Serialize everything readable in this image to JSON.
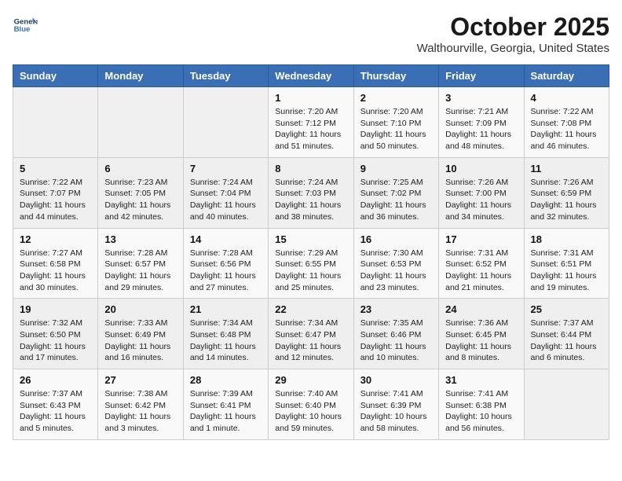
{
  "header": {
    "logo_line1": "General",
    "logo_line2": "Blue",
    "month": "October 2025",
    "location": "Walthourville, Georgia, United States"
  },
  "days_of_week": [
    "Sunday",
    "Monday",
    "Tuesday",
    "Wednesday",
    "Thursday",
    "Friday",
    "Saturday"
  ],
  "weeks": [
    [
      {
        "day": "",
        "info": ""
      },
      {
        "day": "",
        "info": ""
      },
      {
        "day": "",
        "info": ""
      },
      {
        "day": "1",
        "info": "Sunrise: 7:20 AM\nSunset: 7:12 PM\nDaylight: 11 hours and 51 minutes."
      },
      {
        "day": "2",
        "info": "Sunrise: 7:20 AM\nSunset: 7:10 PM\nDaylight: 11 hours and 50 minutes."
      },
      {
        "day": "3",
        "info": "Sunrise: 7:21 AM\nSunset: 7:09 PM\nDaylight: 11 hours and 48 minutes."
      },
      {
        "day": "4",
        "info": "Sunrise: 7:22 AM\nSunset: 7:08 PM\nDaylight: 11 hours and 46 minutes."
      }
    ],
    [
      {
        "day": "5",
        "info": "Sunrise: 7:22 AM\nSunset: 7:07 PM\nDaylight: 11 hours and 44 minutes."
      },
      {
        "day": "6",
        "info": "Sunrise: 7:23 AM\nSunset: 7:05 PM\nDaylight: 11 hours and 42 minutes."
      },
      {
        "day": "7",
        "info": "Sunrise: 7:24 AM\nSunset: 7:04 PM\nDaylight: 11 hours and 40 minutes."
      },
      {
        "day": "8",
        "info": "Sunrise: 7:24 AM\nSunset: 7:03 PM\nDaylight: 11 hours and 38 minutes."
      },
      {
        "day": "9",
        "info": "Sunrise: 7:25 AM\nSunset: 7:02 PM\nDaylight: 11 hours and 36 minutes."
      },
      {
        "day": "10",
        "info": "Sunrise: 7:26 AM\nSunset: 7:00 PM\nDaylight: 11 hours and 34 minutes."
      },
      {
        "day": "11",
        "info": "Sunrise: 7:26 AM\nSunset: 6:59 PM\nDaylight: 11 hours and 32 minutes."
      }
    ],
    [
      {
        "day": "12",
        "info": "Sunrise: 7:27 AM\nSunset: 6:58 PM\nDaylight: 11 hours and 30 minutes."
      },
      {
        "day": "13",
        "info": "Sunrise: 7:28 AM\nSunset: 6:57 PM\nDaylight: 11 hours and 29 minutes."
      },
      {
        "day": "14",
        "info": "Sunrise: 7:28 AM\nSunset: 6:56 PM\nDaylight: 11 hours and 27 minutes."
      },
      {
        "day": "15",
        "info": "Sunrise: 7:29 AM\nSunset: 6:55 PM\nDaylight: 11 hours and 25 minutes."
      },
      {
        "day": "16",
        "info": "Sunrise: 7:30 AM\nSunset: 6:53 PM\nDaylight: 11 hours and 23 minutes."
      },
      {
        "day": "17",
        "info": "Sunrise: 7:31 AM\nSunset: 6:52 PM\nDaylight: 11 hours and 21 minutes."
      },
      {
        "day": "18",
        "info": "Sunrise: 7:31 AM\nSunset: 6:51 PM\nDaylight: 11 hours and 19 minutes."
      }
    ],
    [
      {
        "day": "19",
        "info": "Sunrise: 7:32 AM\nSunset: 6:50 PM\nDaylight: 11 hours and 17 minutes."
      },
      {
        "day": "20",
        "info": "Sunrise: 7:33 AM\nSunset: 6:49 PM\nDaylight: 11 hours and 16 minutes."
      },
      {
        "day": "21",
        "info": "Sunrise: 7:34 AM\nSunset: 6:48 PM\nDaylight: 11 hours and 14 minutes."
      },
      {
        "day": "22",
        "info": "Sunrise: 7:34 AM\nSunset: 6:47 PM\nDaylight: 11 hours and 12 minutes."
      },
      {
        "day": "23",
        "info": "Sunrise: 7:35 AM\nSunset: 6:46 PM\nDaylight: 11 hours and 10 minutes."
      },
      {
        "day": "24",
        "info": "Sunrise: 7:36 AM\nSunset: 6:45 PM\nDaylight: 11 hours and 8 minutes."
      },
      {
        "day": "25",
        "info": "Sunrise: 7:37 AM\nSunset: 6:44 PM\nDaylight: 11 hours and 6 minutes."
      }
    ],
    [
      {
        "day": "26",
        "info": "Sunrise: 7:37 AM\nSunset: 6:43 PM\nDaylight: 11 hours and 5 minutes."
      },
      {
        "day": "27",
        "info": "Sunrise: 7:38 AM\nSunset: 6:42 PM\nDaylight: 11 hours and 3 minutes."
      },
      {
        "day": "28",
        "info": "Sunrise: 7:39 AM\nSunset: 6:41 PM\nDaylight: 11 hours and 1 minute."
      },
      {
        "day": "29",
        "info": "Sunrise: 7:40 AM\nSunset: 6:40 PM\nDaylight: 10 hours and 59 minutes."
      },
      {
        "day": "30",
        "info": "Sunrise: 7:41 AM\nSunset: 6:39 PM\nDaylight: 10 hours and 58 minutes."
      },
      {
        "day": "31",
        "info": "Sunrise: 7:41 AM\nSunset: 6:38 PM\nDaylight: 10 hours and 56 minutes."
      },
      {
        "day": "",
        "info": ""
      }
    ]
  ]
}
